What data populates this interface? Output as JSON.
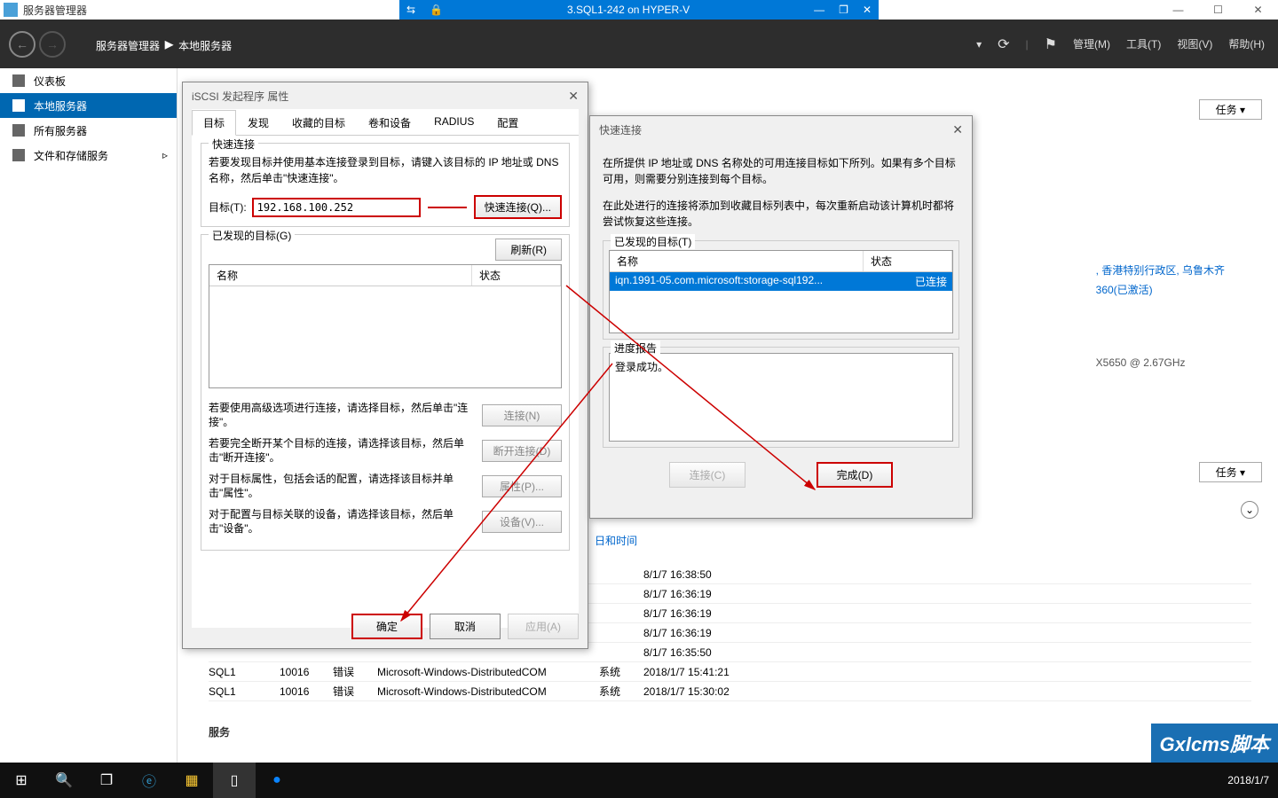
{
  "app": {
    "title": "服务器管理器"
  },
  "vm": {
    "title": "3.SQL1-242 on HYPER-V"
  },
  "breadcrumb": {
    "a": "服务器管理器",
    "b": "本地服务器"
  },
  "menus": {
    "manage": "管理(M)",
    "tools": "工具(T)",
    "view": "视图(V)",
    "help": "帮助(H)"
  },
  "sidebar": {
    "items": [
      {
        "label": "仪表板"
      },
      {
        "label": "本地服务器"
      },
      {
        "label": "所有服务器"
      },
      {
        "label": "文件和存储服务"
      }
    ]
  },
  "tasks_btn": "任务",
  "info": {
    "line1": ", 香港特别行政区, 乌鲁木齐",
    "line2": "360(已激活)",
    "cpu": "X5650  @ 2.67GHz"
  },
  "datetime_link": "日和时间",
  "events": [
    {
      "t": "8/1/7 16:38:50"
    },
    {
      "t": "8/1/7 16:36:19"
    },
    {
      "t": "8/1/7 16:36:19"
    },
    {
      "t": "8/1/7 16:36:19"
    },
    {
      "t": "8/1/7 16:35:50"
    },
    {
      "srv": "SQL1",
      "id": "10016",
      "sev": "错误",
      "src": "Microsoft-Windows-DistributedCOM",
      "log": "系统",
      "t": "2018/1/7 15:41:21"
    },
    {
      "srv": "SQL1",
      "id": "10016",
      "sev": "错误",
      "src": "Microsoft-Windows-DistributedCOM",
      "log": "系统",
      "t": "2018/1/7 15:30:02"
    }
  ],
  "footer_label": "服务",
  "dlg1": {
    "title": "iSCSI 发起程序 属性",
    "tabs": [
      "目标",
      "发现",
      "收藏的目标",
      "卷和设备",
      "RADIUS",
      "配置"
    ],
    "grp_qc": "快速连接",
    "qc_text": "若要发现目标并使用基本连接登录到目标，请键入该目标的 IP 地址或 DNS 名称，然后单击\"快速连接\"。",
    "target_label": "目标(T):",
    "target_value": "192.168.100.252",
    "qc_btn": "快速连接(Q)...",
    "grp_found": "已发现的目标(G)",
    "refresh": "刷新(R)",
    "col_name": "名称",
    "col_status": "状态",
    "hint_connect": "若要使用高级选项进行连接，请选择目标，然后单击\"连接\"。",
    "hint_disconnect": "若要完全断开某个目标的连接，请选择该目标，然后单击\"断开连接\"。",
    "hint_props": "对于目标属性，包括会话的配置，请选择该目标并单击\"属性\"。",
    "hint_devices": "对于配置与目标关联的设备，请选择该目标，然后单击\"设备\"。",
    "btn_connect": "连接(N)",
    "btn_disconnect": "断开连接(D)",
    "btn_props": "属性(P)...",
    "btn_devices": "设备(V)...",
    "ok": "确定",
    "cancel": "取消",
    "apply": "应用(A)"
  },
  "dlg2": {
    "title": "快速连接",
    "info1": "在所提供 IP 地址或 DNS 名称处的可用连接目标如下所列。如果有多个目标可用，则需要分别连接到每个目标。",
    "info2": "在此处进行的连接将添加到收藏目标列表中，每次重新启动该计算机时都将尝试恢复这些连接。",
    "grp_found": "已发现的目标(T)",
    "col_name": "名称",
    "col_status": "状态",
    "row_name": "iqn.1991-05.com.microsoft:storage-sql192...",
    "row_status": "已连接",
    "grp_progress": "进度报告",
    "progress_text": "登录成功。",
    "connect": "连接(C)",
    "done": "完成(D)"
  },
  "taskbar": {
    "date": "2018/1/7"
  },
  "watermark": "Gxlcms脚本"
}
